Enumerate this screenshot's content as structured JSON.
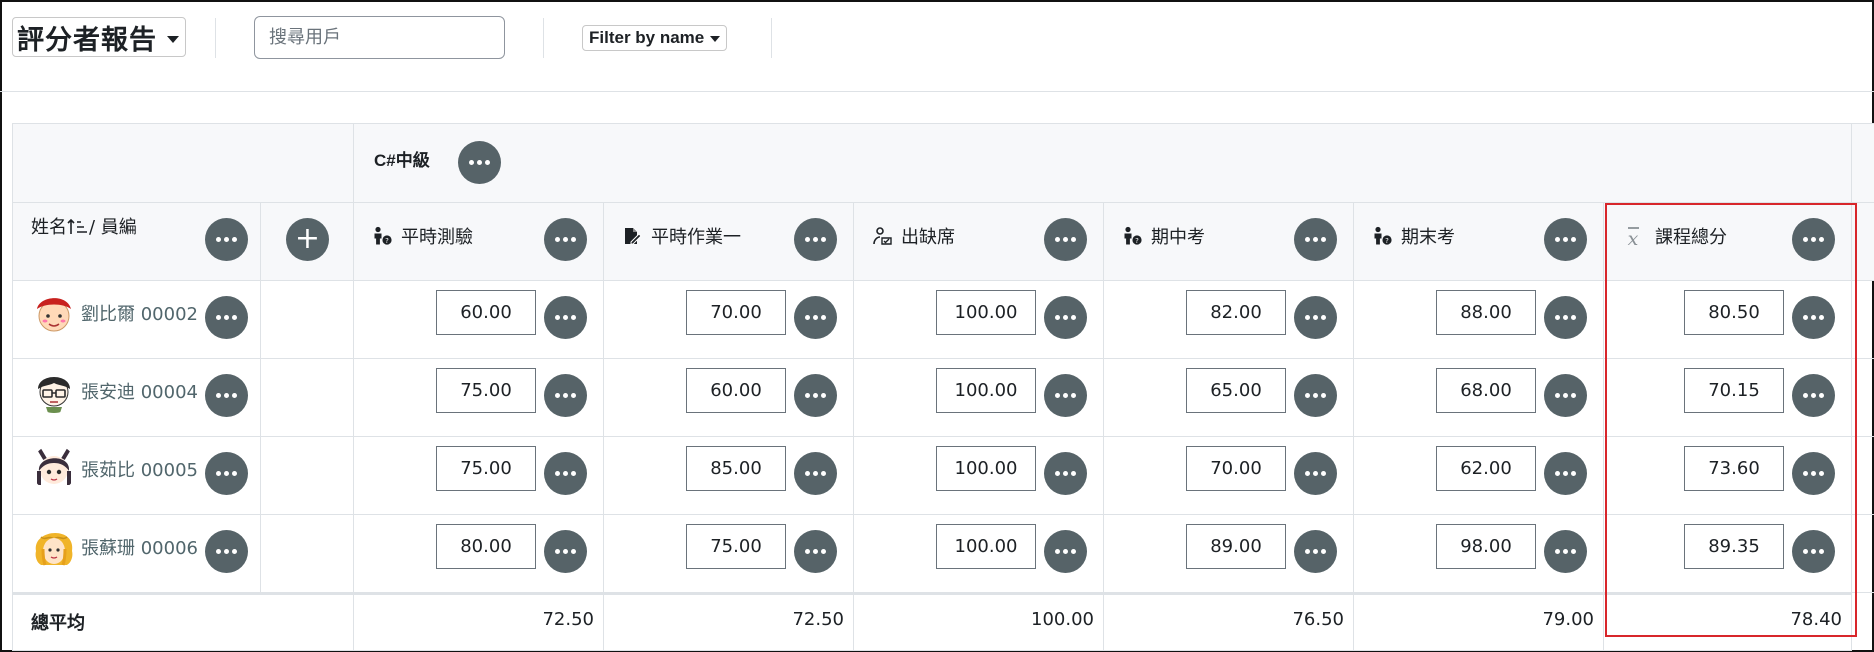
{
  "toolbar": {
    "report_label": "評分者報告",
    "search_placeholder": "搜尋用戶",
    "filter_label": "Filter by name"
  },
  "grid": {
    "category": "C#中級",
    "name_header": "姓名",
    "id_header": "/ 員編",
    "columns": [
      {
        "label": "平時測驗",
        "icon": "manual-grade-icon"
      },
      {
        "label": "平時作業一",
        "icon": "assignment-icon"
      },
      {
        "label": "出缺席",
        "icon": "attendance-icon"
      },
      {
        "label": "期中考",
        "icon": "manual-grade-icon"
      },
      {
        "label": "期末考",
        "icon": "manual-grade-icon"
      },
      {
        "label": "課程總分",
        "icon": "mean-xbar-icon"
      }
    ],
    "students": [
      {
        "name": "劉比爾 00002",
        "grades": [
          "60.00",
          "70.00",
          "100.00",
          "82.00",
          "88.00",
          "80.50"
        ]
      },
      {
        "name": "張安迪 00004",
        "grades": [
          "75.00",
          "60.00",
          "100.00",
          "65.00",
          "68.00",
          "70.15"
        ]
      },
      {
        "name": "張茹比 00005",
        "grades": [
          "75.00",
          "85.00",
          "100.00",
          "70.00",
          "62.00",
          "73.60"
        ]
      },
      {
        "name": "張蘇珊 00006",
        "grades": [
          "80.00",
          "75.00",
          "100.00",
          "89.00",
          "98.00",
          "89.35"
        ]
      }
    ],
    "average_label": "總平均",
    "averages": [
      "72.50",
      "72.50",
      "100.00",
      "76.50",
      "79.00",
      "78.40"
    ]
  },
  "colors": {
    "action_button": "#566368",
    "highlight": "#d8262b",
    "student_link": "#51666c"
  }
}
